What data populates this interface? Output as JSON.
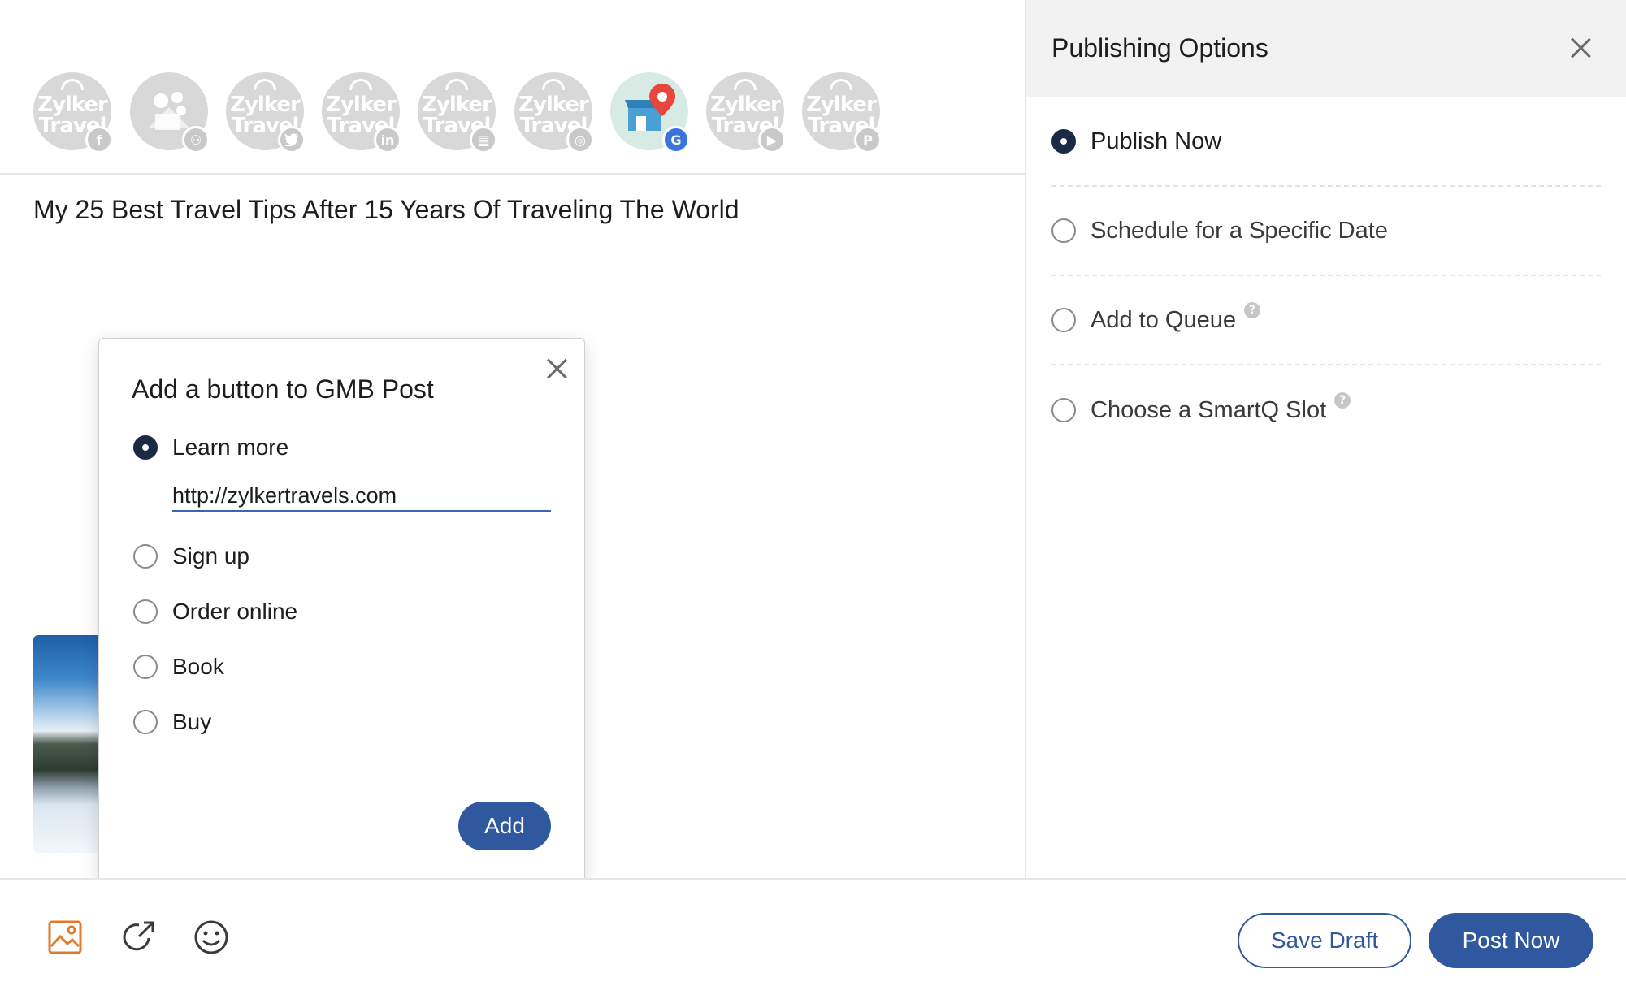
{
  "accounts": [
    {
      "logo_line1": "Zylker",
      "logo_line2": "Travel",
      "network": "facebook",
      "badge_glyph": "f"
    },
    {
      "network": "facebook-groups",
      "badge_glyph": "⚇"
    },
    {
      "logo_line1": "Zylker",
      "logo_line2": "Travel",
      "network": "twitter",
      "badge_glyph": "•"
    },
    {
      "logo_line1": "Zylker",
      "logo_line2": "Travel",
      "network": "linkedin",
      "badge_glyph": "in"
    },
    {
      "logo_line1": "Zylker",
      "logo_line2": "Travel",
      "network": "linkedin-page",
      "badge_glyph": "▤"
    },
    {
      "logo_line1": "Zylker",
      "logo_line2": "Travel",
      "network": "instagram",
      "badge_glyph": "◎"
    },
    {
      "network": "google-my-business",
      "badge_glyph": "G",
      "active": true
    },
    {
      "logo_line1": "Zylker",
      "logo_line2": "Travel",
      "network": "youtube",
      "badge_glyph": "▶"
    },
    {
      "logo_line1": "Zylker",
      "logo_line2": "Travel",
      "network": "pinterest",
      "badge_glyph": "P"
    }
  ],
  "post": {
    "title": "My 25 Best Travel Tips After 15 Years Of Traveling The World"
  },
  "popup": {
    "title": "Add a button to GMB Post",
    "options": [
      {
        "label": "Learn more",
        "checked": true
      },
      {
        "label": "Sign up",
        "checked": false
      },
      {
        "label": "Order online",
        "checked": false
      },
      {
        "label": "Book",
        "checked": false
      },
      {
        "label": "Buy",
        "checked": false
      }
    ],
    "url_value": "http://zylkertravels.com",
    "add_label": "Add"
  },
  "publishing": {
    "title": "Publishing Options",
    "options": [
      {
        "label": "Publish Now",
        "selected": true,
        "help": false
      },
      {
        "label": "Schedule for a Specific Date",
        "selected": false,
        "help": false
      },
      {
        "label": "Add to Queue",
        "selected": false,
        "help": true
      },
      {
        "label": "Choose a SmartQ Slot",
        "selected": false,
        "help": true
      }
    ],
    "help_glyph": "?"
  },
  "toolbar": {
    "tools": [
      "image-icon",
      "link-share-icon",
      "emoji-icon"
    ],
    "colors": {
      "image": "#e07b2c",
      "other": "#3a3a3a"
    },
    "save_draft_label": "Save Draft",
    "post_now_label": "Post Now"
  },
  "colors": {
    "primary": "#30589f",
    "radio_checked": "#1b2a44",
    "header_bg": "#f2f2f2"
  }
}
